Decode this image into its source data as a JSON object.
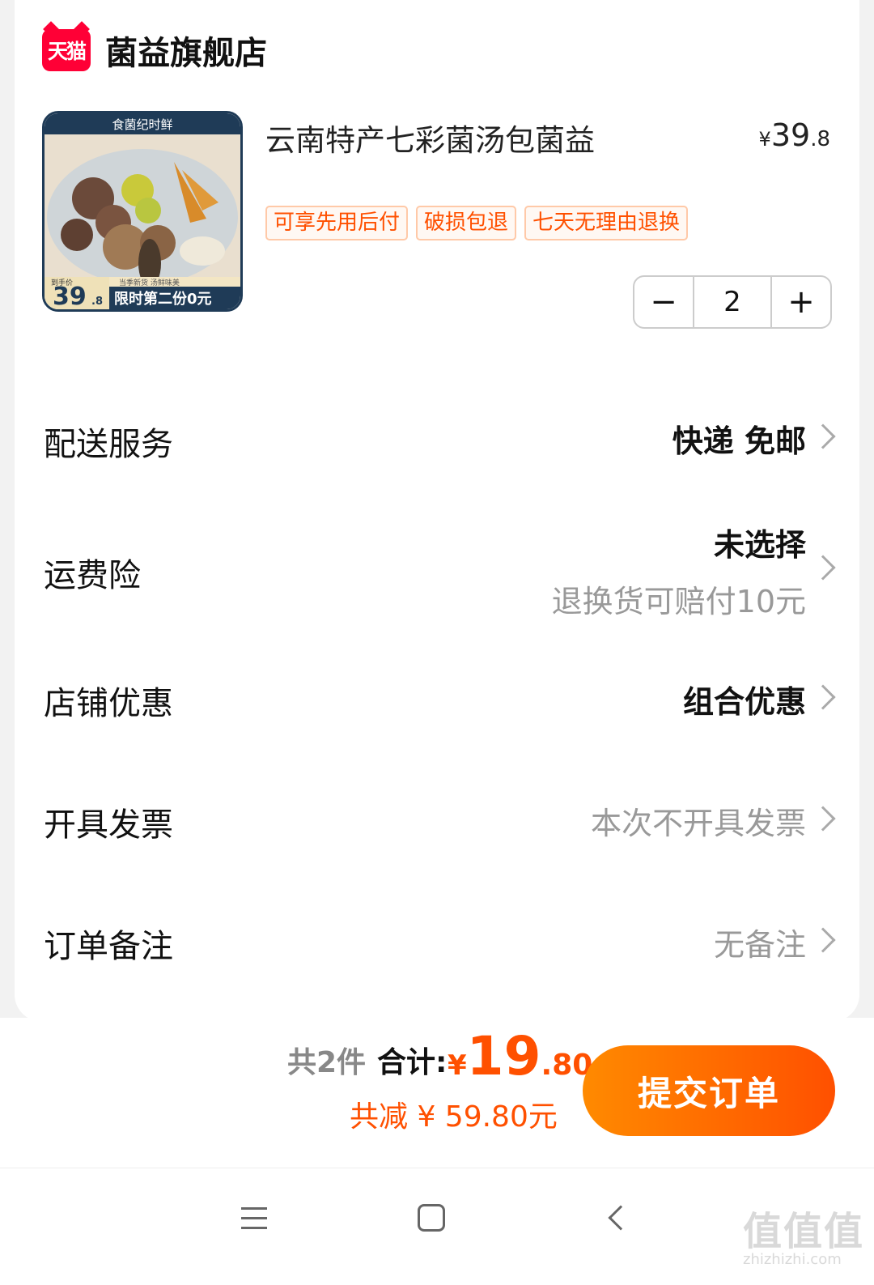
{
  "store": {
    "logo_text": "天猫",
    "name": "菌益旗舰店"
  },
  "product": {
    "title": "云南特产七彩菌汤包菌益",
    "price_currency": "¥",
    "price_int": "39",
    "price_dec": ".8",
    "tags": [
      "可享先用后付",
      "破损包退",
      "七天无理由退换"
    ],
    "quantity": "2",
    "minus_label": "−",
    "plus_label": "+",
    "image_brand": "食菌纪时鲜",
    "image_subtitle": "当季新货 汤鲜味美",
    "image_price_label": "到手价",
    "image_price": "39",
    "image_price_dec": ".8",
    "image_promo": "限时第二份0元"
  },
  "rows": [
    {
      "label": "配送服务",
      "value": "快递 免邮"
    },
    {
      "label": "运费险",
      "value": "未选择",
      "sub": "退换货可赔付10元"
    },
    {
      "label": "店铺优惠",
      "value": "组合优惠"
    },
    {
      "label": "开具发票",
      "value": "本次不开具发票"
    },
    {
      "label": "订单备注",
      "value": "无备注"
    }
  ],
  "summary": {
    "count": "共2件",
    "total_label": "合计:",
    "total_currency": "¥",
    "total_int": "19",
    "total_dec": ".80",
    "saved": "共减 ¥ 59.80元",
    "submit_label": "提交订单"
  },
  "watermark": {
    "big": "值值值",
    "small": "zhizhizhi.com"
  },
  "colors": {
    "accent": "#ff5000",
    "tmall_red": "#ff0036",
    "gradient_start": "#ff8a00"
  }
}
